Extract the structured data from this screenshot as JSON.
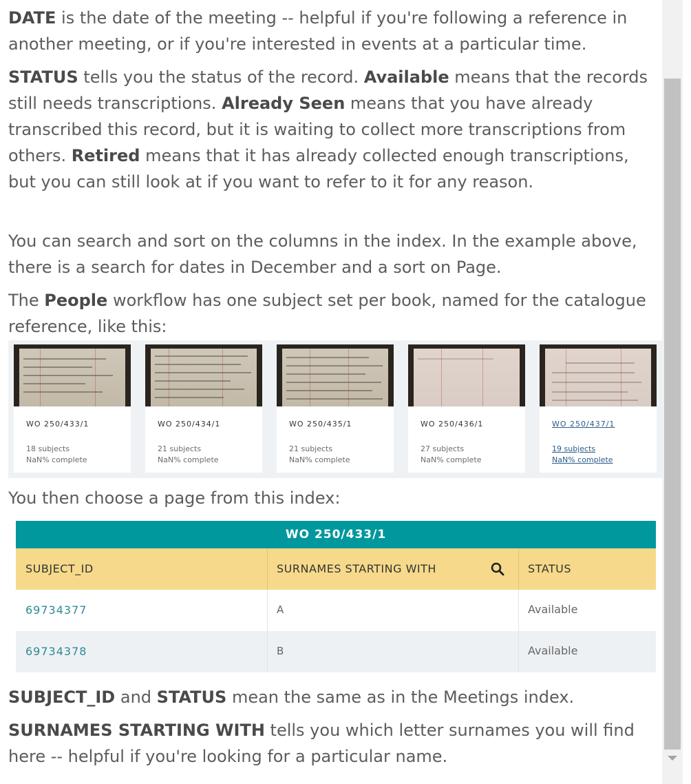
{
  "paragraphs": {
    "date": {
      "term": "DATE",
      "text": " is the date of the meeting -- helpful if you're following a reference in another meeting, or if you're interested in events at a particular time."
    },
    "status": {
      "term": "STATUS",
      "t1": " tells you the status of the record. ",
      "available": "Available",
      "t2": " means that the records still needs transcriptions. ",
      "seen": "Already Seen",
      "t3": " means that you have already transcribed this record, but it is waiting to collect more transcriptions from others. ",
      "retired": "Retired",
      "t4": " means that it has already collected enough transcriptions, but you can still look at if you want to refer to it for any reason."
    },
    "search": "You can search and sort on the columns in the index. In the example above, there is a search for dates in December and a sort on Page.",
    "people": {
      "t1": "The ",
      "term": "People",
      "t2": " workflow has one subject set per book, named for the catalogue reference, like this:"
    },
    "choose": "You then choose a page from this index:",
    "subject_status": {
      "term1": "SUBJECT_ID",
      "t1": " and ",
      "term2": "STATUS",
      "t2": " mean the same as in the Meetings index."
    },
    "surnames": {
      "term": "SURNAMES STARTING WITH",
      "t1": " tells you which letter surnames you will find here -- helpful if you're looking for a particular name."
    }
  },
  "subject_sets": [
    {
      "title": "WO 250/433/1",
      "subjects": "18 subjects",
      "complete": "NaN% complete"
    },
    {
      "title": "WO 250/434/1",
      "subjects": "21 subjects",
      "complete": "NaN% complete"
    },
    {
      "title": "WO 250/435/1",
      "subjects": "21 subjects",
      "complete": "NaN% complete"
    },
    {
      "title": "WO 250/436/1",
      "subjects": "27 subjects",
      "complete": "NaN% complete"
    },
    {
      "title": "WO 250/437/1",
      "subjects": "19 subjects",
      "complete": "NaN% complete"
    }
  ],
  "index_table": {
    "title": "WO 250/433/1",
    "headers": [
      "SUBJECT_ID",
      "SURNAMES STARTING WITH",
      "STATUS"
    ],
    "rows": [
      {
        "subject_id": "69734377",
        "surnames": "A",
        "status": "Available"
      },
      {
        "subject_id": "69734378",
        "surnames": "B",
        "status": "Available"
      }
    ]
  },
  "colors": {
    "teal_header": "#00979d",
    "yellow_header": "#f6d98a",
    "link": "#2c8a94"
  }
}
